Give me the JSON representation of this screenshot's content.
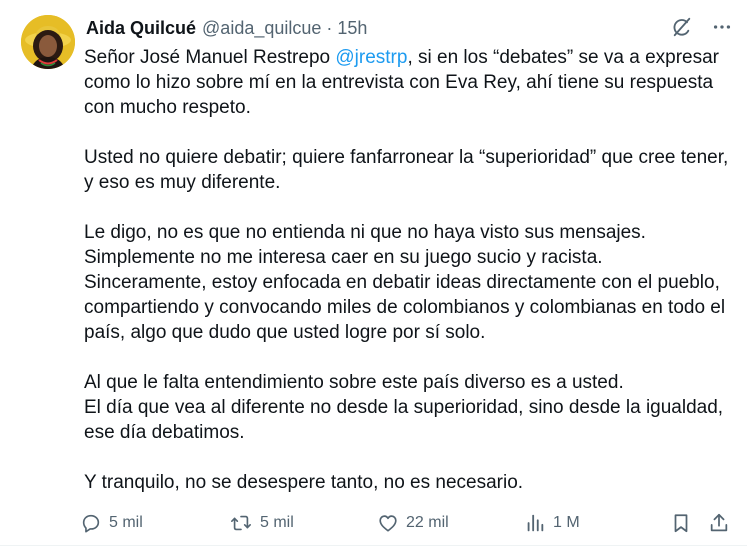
{
  "tweet": {
    "author": {
      "display_name": "Aida Quilcué",
      "handle": "@aida_quilcue",
      "separator": "·",
      "time": "15h",
      "avatar": "profile-photo"
    },
    "top_icons": [
      "grok-icon",
      "more-icon"
    ],
    "body": {
      "p1_before": "Señor José Manuel Restrepo ",
      "p1_mention": "@jrestrp",
      "p1_after": ", si en los “debates” se va a expresar como lo hizo sobre mí en la entrevista con Eva Rey, ahí tiene su respuesta con mucho respeto.",
      "p2": "Usted no quiere debatir; quiere fanfarronear la “superioridad” que cree tener, y eso es muy diferente.",
      "p3": "Le digo, no es que no entienda ni que no haya visto sus mensajes.\nSimplemente no me interesa caer en su juego sucio y racista.\nSinceramente, estoy enfocada en debatir ideas directamente con el pueblo, compartiendo y convocando miles de colombianos y colombianas en todo el país, algo que dudo que usted logre por sí solo.",
      "p4": "Al que le falta entendimiento sobre este país diverso es a usted.\nEl día que vea al diferente no desde la superioridad, sino desde la igualdad, ese día debatimos.",
      "p5": "Y tranquilo, no se desespere tanto, no es necesario."
    },
    "actions": {
      "replies": "5 mil",
      "reposts": "5 mil",
      "likes": "22 mil",
      "views": "1 M"
    },
    "colors": {
      "text": "#0f1419",
      "secondary": "#536471",
      "link": "#1d9bf0"
    }
  }
}
